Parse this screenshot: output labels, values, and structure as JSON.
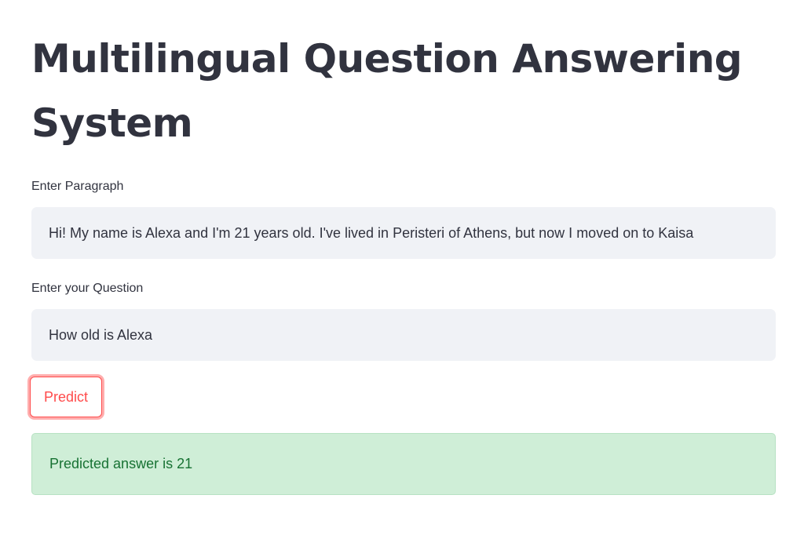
{
  "app": {
    "title": "Multilingual Question Answering System"
  },
  "form": {
    "paragraph_label": "Enter Paragraph",
    "paragraph_value": "Hi! My name is Alexa and I'm 21 years old. I've lived in Peristeri of Athens, but now I moved on to Kaisa",
    "question_label": "Enter your Question",
    "question_value": "How old is Alexa",
    "predict_label": "Predict"
  },
  "result": {
    "text": "Predicted answer is 21"
  },
  "colors": {
    "accent": "#ff4b4b",
    "success_bg": "#cfeed7",
    "success_text": "#177233",
    "input_bg": "#f0f2f6",
    "text": "#31333f"
  }
}
